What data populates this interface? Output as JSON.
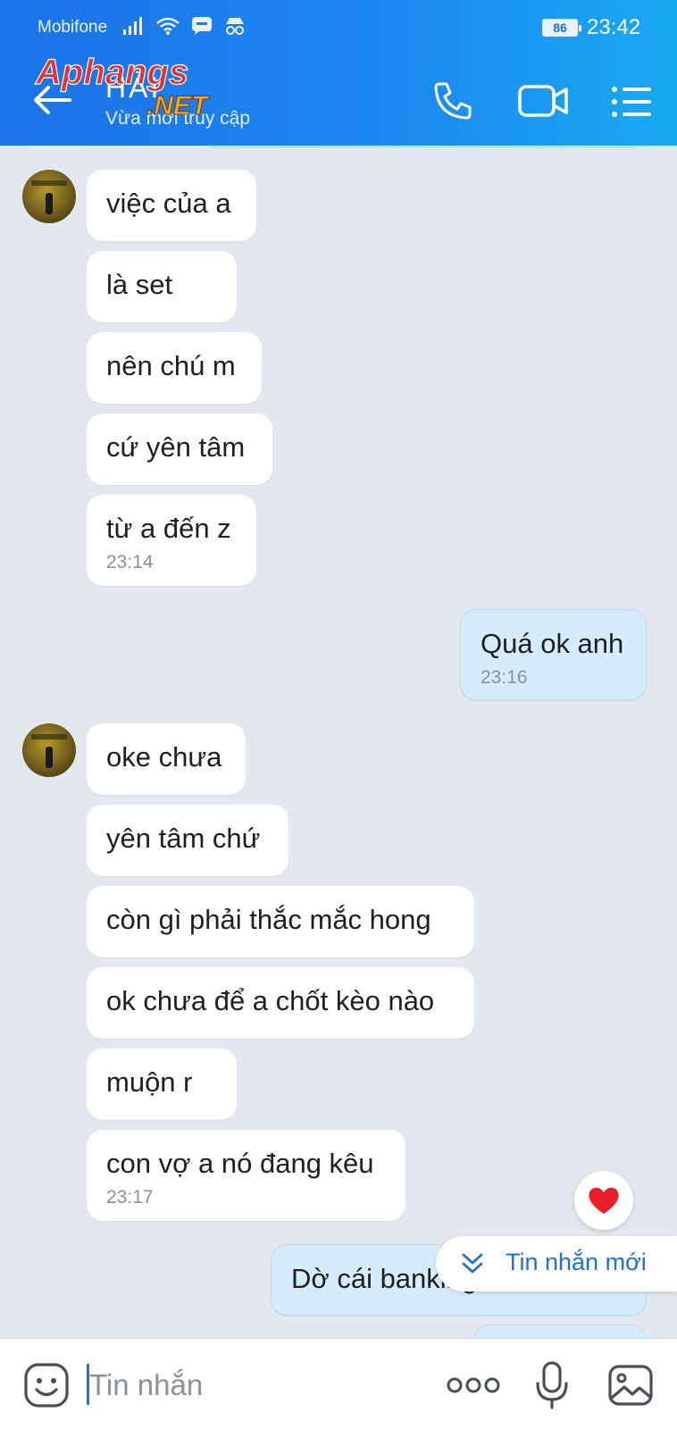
{
  "status_bar": {
    "carrier": "Mobifone",
    "battery": "86",
    "time": "23:42"
  },
  "header": {
    "contact_name": "HẢI",
    "contact_status": "Vừa mới truy cập",
    "watermark": "Aphangs.NET"
  },
  "messages": [
    {
      "text": "việc của a"
    },
    {
      "text": "là set"
    },
    {
      "text": "nên chú m"
    },
    {
      "text": "cứ yên tâm"
    },
    {
      "text": "từ a đến z",
      "time": "23:14"
    },
    {
      "text": "Quá ok anh",
      "time": "23:16"
    },
    {
      "text": "oke chưa"
    },
    {
      "text": "yên tâm chứ"
    },
    {
      "text": "còn gì phải thắc mắc hong"
    },
    {
      "text": "ok chưa để a chốt kèo nào"
    },
    {
      "text": "muộn r"
    },
    {
      "text": "con vợ a nó đang kêu",
      "time": "23:17"
    },
    {
      "text": "Dờ cái banking k vào dc à"
    }
  ],
  "new_messages_label": "Tin nhắn mới",
  "input": {
    "placeholder": "Tin nhắn"
  },
  "colors": {
    "accent": "#1a73e8",
    "my_bubble": "#d5ecfd",
    "background": "#e3e8ee",
    "heart": "#e8202b"
  }
}
